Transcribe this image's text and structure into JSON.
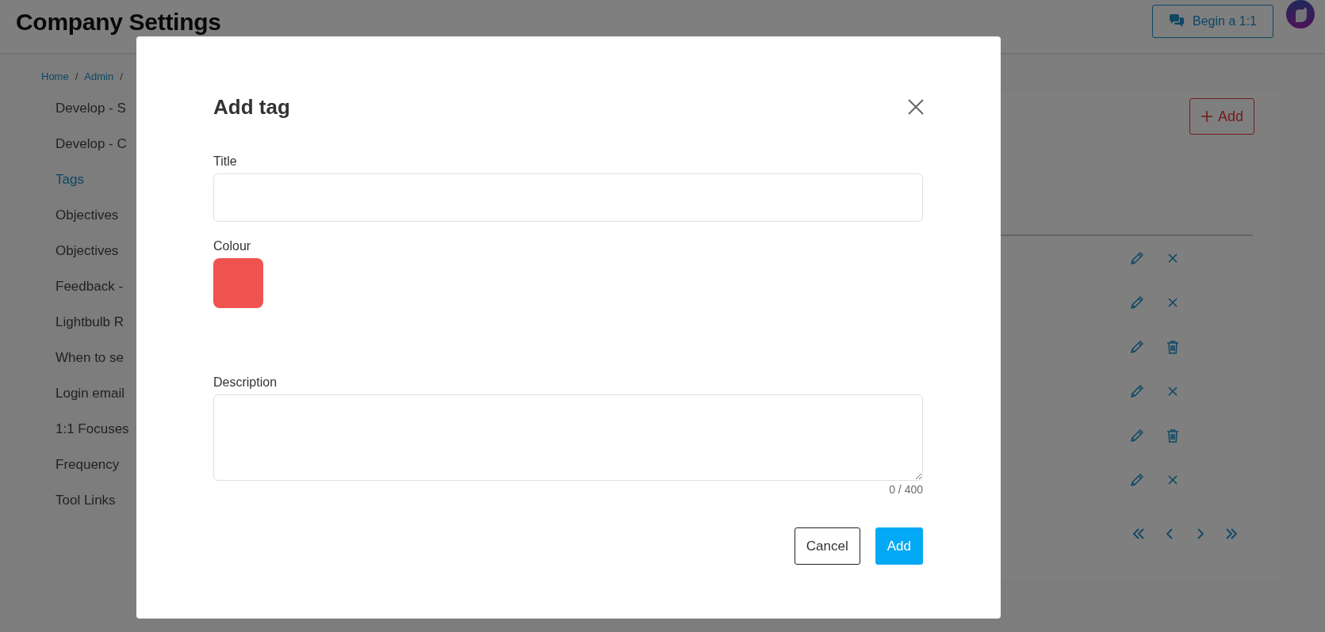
{
  "header": {
    "title": "Company Settings",
    "begin_button": "Begin a 1:1"
  },
  "breadcrumb": {
    "items": [
      "Home",
      "Admin"
    ],
    "separator": "/"
  },
  "sidebar": {
    "items": [
      {
        "label": "Develop - S",
        "selected": false
      },
      {
        "label": "Develop - C",
        "selected": false
      },
      {
        "label": "Tags",
        "selected": true
      },
      {
        "label": "Objectives",
        "selected": false
      },
      {
        "label": "Objectives",
        "selected": false
      },
      {
        "label": "Feedback -",
        "selected": false
      },
      {
        "label": "Lightbulb R",
        "selected": false
      },
      {
        "label": "When to se",
        "selected": false
      },
      {
        "label": "Login email",
        "selected": false
      },
      {
        "label": "1:1 Focuses",
        "selected": false
      },
      {
        "label": "Frequency",
        "selected": false
      },
      {
        "label": "Tool Links",
        "selected": false
      }
    ]
  },
  "card": {
    "add_button": "Add",
    "rows": [
      {
        "actions": [
          {
            "kind": "edit"
          },
          {
            "kind": "remove"
          }
        ]
      },
      {
        "actions": [
          {
            "kind": "edit"
          },
          {
            "kind": "remove"
          }
        ]
      },
      {
        "actions": [
          {
            "kind": "edit"
          },
          {
            "kind": "delete"
          }
        ]
      },
      {
        "actions": [
          {
            "kind": "edit"
          },
          {
            "kind": "remove"
          }
        ]
      },
      {
        "actions": [
          {
            "kind": "edit"
          },
          {
            "kind": "delete"
          }
        ]
      },
      {
        "actions": [
          {
            "kind": "edit"
          },
          {
            "kind": "remove"
          }
        ]
      }
    ],
    "pagination": [
      {
        "kind": "first"
      },
      {
        "kind": "previous"
      },
      {
        "kind": "next"
      },
      {
        "kind": "last"
      }
    ]
  },
  "modal": {
    "title": "Add tag",
    "fields": [
      {
        "kind": "text",
        "label": "Title"
      },
      {
        "kind": "colour",
        "label": "Colour",
        "color": "#ef5350"
      },
      {
        "kind": "textarea",
        "label": "Description",
        "counter": "0 / 400"
      }
    ],
    "buttons": [
      {
        "kind": "secondary",
        "label": "Cancel"
      },
      {
        "kind": "primary",
        "label": "Add"
      }
    ]
  }
}
